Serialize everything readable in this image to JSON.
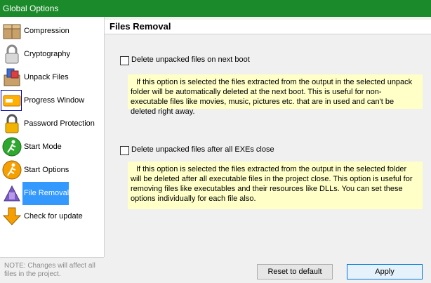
{
  "window": {
    "title": "Global Options"
  },
  "sidebar": {
    "items": [
      {
        "label": "Compression",
        "icon": "box-icon"
      },
      {
        "label": "Cryptography",
        "icon": "padlock-icon"
      },
      {
        "label": "Unpack Files",
        "icon": "unpack-box-icon"
      },
      {
        "label": "Progress Window",
        "icon": "progress-window-icon"
      },
      {
        "label": "Password Protection",
        "icon": "lock-icon"
      },
      {
        "label": "Start Mode",
        "icon": "runner-icon"
      },
      {
        "label": "Start Options",
        "icon": "runner-options-icon"
      },
      {
        "label": "File Removal",
        "icon": "file-removal-icon",
        "selected": true
      },
      {
        "label": "Check for update",
        "icon": "update-arrow-icon"
      }
    ],
    "note": "NOTE: Changes will affect all files in the project."
  },
  "main": {
    "section_title": "Files Removal",
    "options": [
      {
        "label": "Delete unpacked files on next boot",
        "checked": false,
        "description": "If this option is selected the files extracted from the output in the selected unpack folder will be automatically deleted at the next boot. This is useful for non-executable files like movies, music, pictures etc. that are in used and can't be deleted right away."
      },
      {
        "label": "Delete unpacked files after all EXEs close",
        "checked": false,
        "description": "If this option is selected the files extracted from the output in the selected folder will be deleted after all executable files in the project close. This option is useful for removing files like executables and their resources like DLLs. You can set these options individually for each file also."
      }
    ]
  },
  "buttons": {
    "reset": "Reset to default",
    "apply": "Apply"
  },
  "colors": {
    "titlebar": "#1b8a2a",
    "selection": "#3399ff",
    "description_bg": "#ffffc8"
  }
}
